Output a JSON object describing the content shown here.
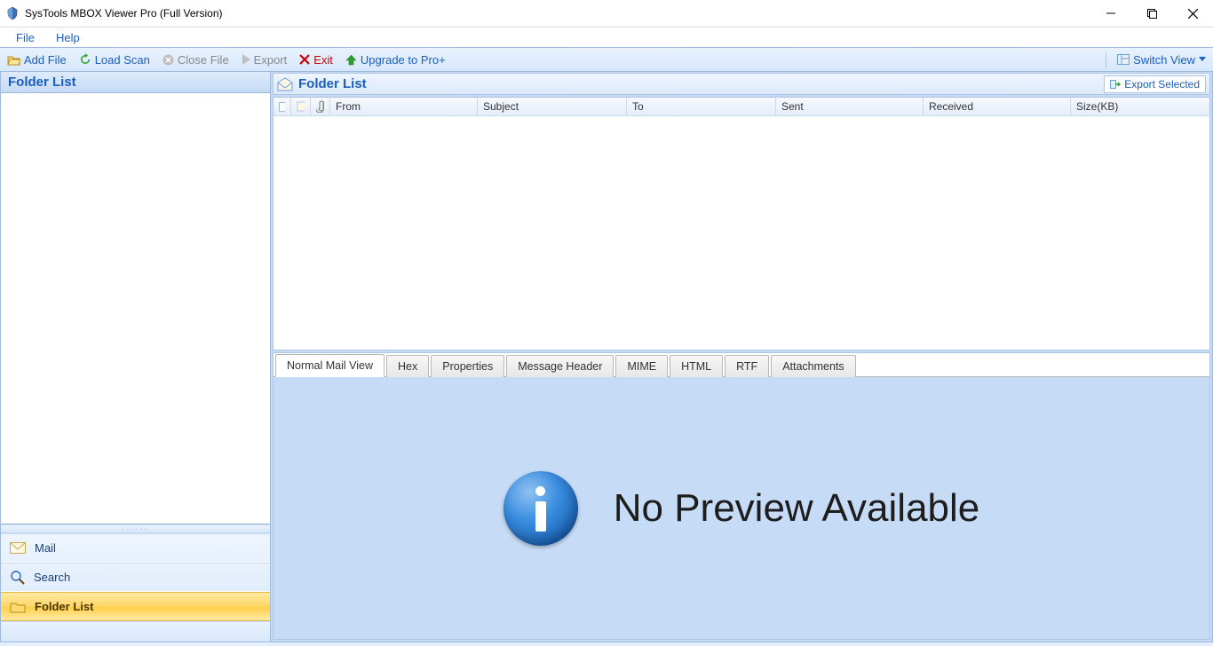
{
  "window": {
    "title": "SysTools MBOX Viewer Pro (Full Version)"
  },
  "menubar": {
    "file": "File",
    "help": "Help"
  },
  "toolbar": {
    "add_file": "Add File",
    "load_scan": "Load Scan",
    "close_file": "Close File",
    "export": "Export",
    "exit": "Exit",
    "upgrade": "Upgrade to Pro+",
    "switch_view": "Switch View"
  },
  "left_pane": {
    "header": "Folder List",
    "nav": {
      "mail": "Mail",
      "search": "Search",
      "folder_list": "Folder List"
    }
  },
  "right_top": {
    "header": "Folder List",
    "export_selected": "Export Selected",
    "columns": {
      "from": "From",
      "subject": "Subject",
      "to": "To",
      "sent": "Sent",
      "received": "Received",
      "size": "Size(KB)"
    }
  },
  "tabs": {
    "normal": "Normal Mail View",
    "hex": "Hex",
    "properties": "Properties",
    "message_header": "Message Header",
    "mime": "MIME",
    "html": "HTML",
    "rtf": "RTF",
    "attachments": "Attachments"
  },
  "preview": {
    "no_preview": "No Preview Available"
  }
}
